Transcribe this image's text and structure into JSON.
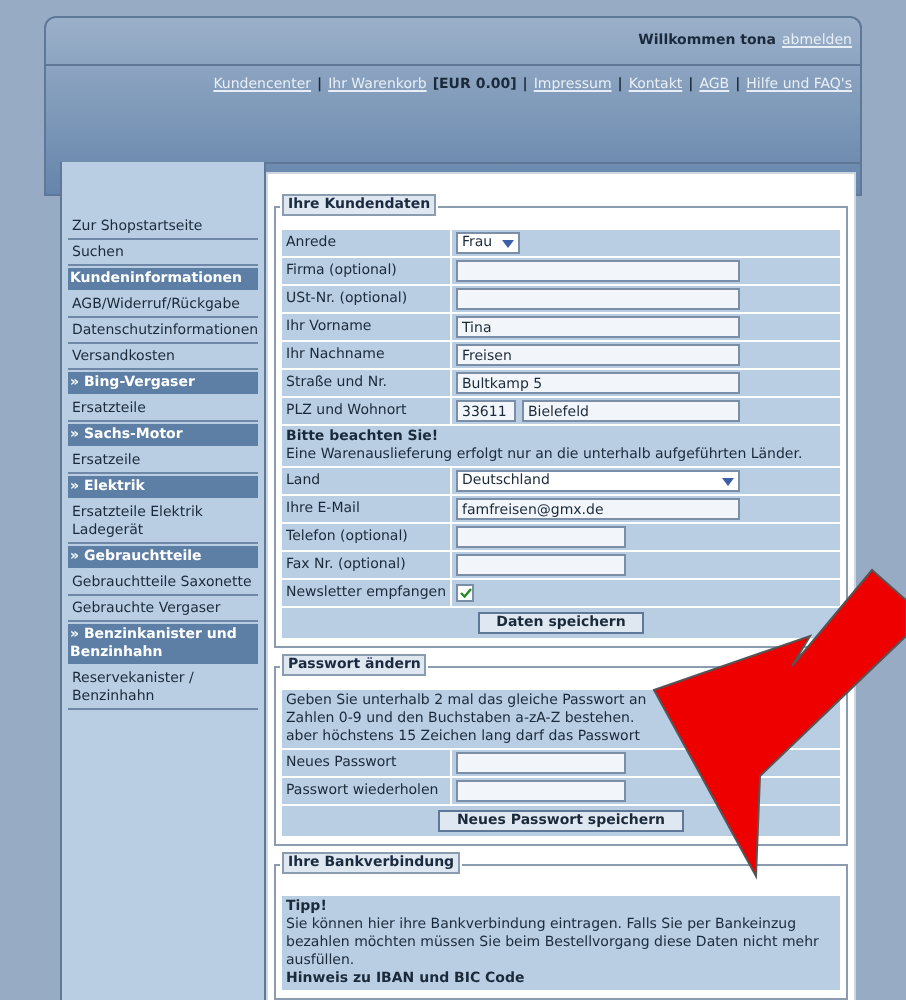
{
  "header": {
    "welcome": "Willkommen tona",
    "logout": "abmelden",
    "nav": [
      {
        "kind": "link",
        "text": "Kundencenter"
      },
      {
        "kind": "sep",
        "text": "|"
      },
      {
        "kind": "link",
        "text": "Ihr Warenkorb"
      },
      {
        "kind": "text",
        "text": "[EUR 0.00]"
      },
      {
        "kind": "sep",
        "text": "|"
      },
      {
        "kind": "link",
        "text": "Impressum"
      },
      {
        "kind": "sep",
        "text": "|"
      },
      {
        "kind": "link",
        "text": "Kontakt"
      },
      {
        "kind": "sep",
        "text": "|"
      },
      {
        "kind": "link",
        "text": "AGB"
      },
      {
        "kind": "sep",
        "text": "|"
      },
      {
        "kind": "link",
        "text": "Hilfe und FAQ's"
      }
    ]
  },
  "sidebar": {
    "items": [
      {
        "kind": "link",
        "text": "Zur Shopstartseite"
      },
      {
        "kind": "link",
        "text": "Suchen"
      },
      {
        "kind": "category",
        "text": "Kundeninformationen"
      },
      {
        "kind": "link",
        "text": "AGB/Widerruf/Rückgabe"
      },
      {
        "kind": "link",
        "text": "Datenschutzinformationen"
      },
      {
        "kind": "link",
        "text": "Versandkosten"
      },
      {
        "kind": "category",
        "text": "» Bing-Vergaser"
      },
      {
        "kind": "link",
        "text": "Ersatzteile"
      },
      {
        "kind": "category",
        "text": "» Sachs-Motor"
      },
      {
        "kind": "link",
        "text": "Ersatzeile"
      },
      {
        "kind": "category",
        "text": "» Elektrik"
      },
      {
        "kind": "link",
        "text": "Ersatzteile Elektrik Ladegerät"
      },
      {
        "kind": "category",
        "text": "» Gebrauchtteile"
      },
      {
        "kind": "link",
        "text": "Gebrauchtteile Saxonette"
      },
      {
        "kind": "link",
        "text": "Gebrauchte Vergaser"
      },
      {
        "kind": "category",
        "text": "» Benzinkanister und Benzinhahn"
      },
      {
        "kind": "link",
        "text": "Reservekanister / Benzinhahn"
      }
    ]
  },
  "customer": {
    "title": "Ihre Kundendaten",
    "rows": [
      {
        "kind": "select",
        "label": "Anrede",
        "value": "Frau"
      },
      {
        "kind": "input",
        "label": "Firma (optional)"
      },
      {
        "kind": "input",
        "label": "USt-Nr. (optional)"
      },
      {
        "kind": "input",
        "label": "Ihr Vorname",
        "value": "Tina"
      },
      {
        "kind": "input",
        "label": "Ihr Nachname",
        "value": "Freisen"
      },
      {
        "kind": "input",
        "label": "Straße und Nr.",
        "value": "Bultkamp 5"
      },
      {
        "kind": "zip_city",
        "label": "PLZ und Wohnort",
        "value": "33611",
        "value2": "Bielefeld"
      },
      {
        "kind": "notice",
        "label": "Bitte beachten Sie!",
        "value": "Eine Warenauslieferung erfolgt nur an die unterhalb aufgeführten Länder."
      },
      {
        "kind": "wide_select",
        "label": "Land",
        "value": "Deutschland"
      },
      {
        "kind": "input",
        "label": "Ihre E-Mail",
        "value": "famfreisen@gmx.de"
      },
      {
        "kind": "short_input",
        "label": "Telefon (optional)"
      },
      {
        "kind": "short_input",
        "label": "Fax Nr. (optional)"
      },
      {
        "kind": "checkbox",
        "label": "Newsletter empfangen",
        "checked": true
      }
    ],
    "button": "Daten speichern"
  },
  "password": {
    "title": "Passwort ändern",
    "intro": [
      "Geben Sie unterhalb 2 mal das gleiche Passwort an",
      "Zahlen 0-9 und den Buchstaben a-zA-Z bestehen.",
      "aber höchstens 15 Zeichen lang darf das Passwort"
    ],
    "rows": [
      {
        "kind": "short_input",
        "label": "Neues Passwort"
      },
      {
        "kind": "short_input",
        "label": "Passwort wiederholen"
      }
    ],
    "button": "Neues Passwort speichern"
  },
  "bank": {
    "title": "Ihre Bankverbindung",
    "tip_title": "Tipp!",
    "tip": "Sie können hier ihre Bankverbindung eintragen. Falls Sie per Bankeinzug bezahlen möchten müssen Sie beim Bestellvorgang diese Daten nicht mehr ausfüllen.",
    "hint": "Hinweis zu IBAN und BIC Code"
  }
}
